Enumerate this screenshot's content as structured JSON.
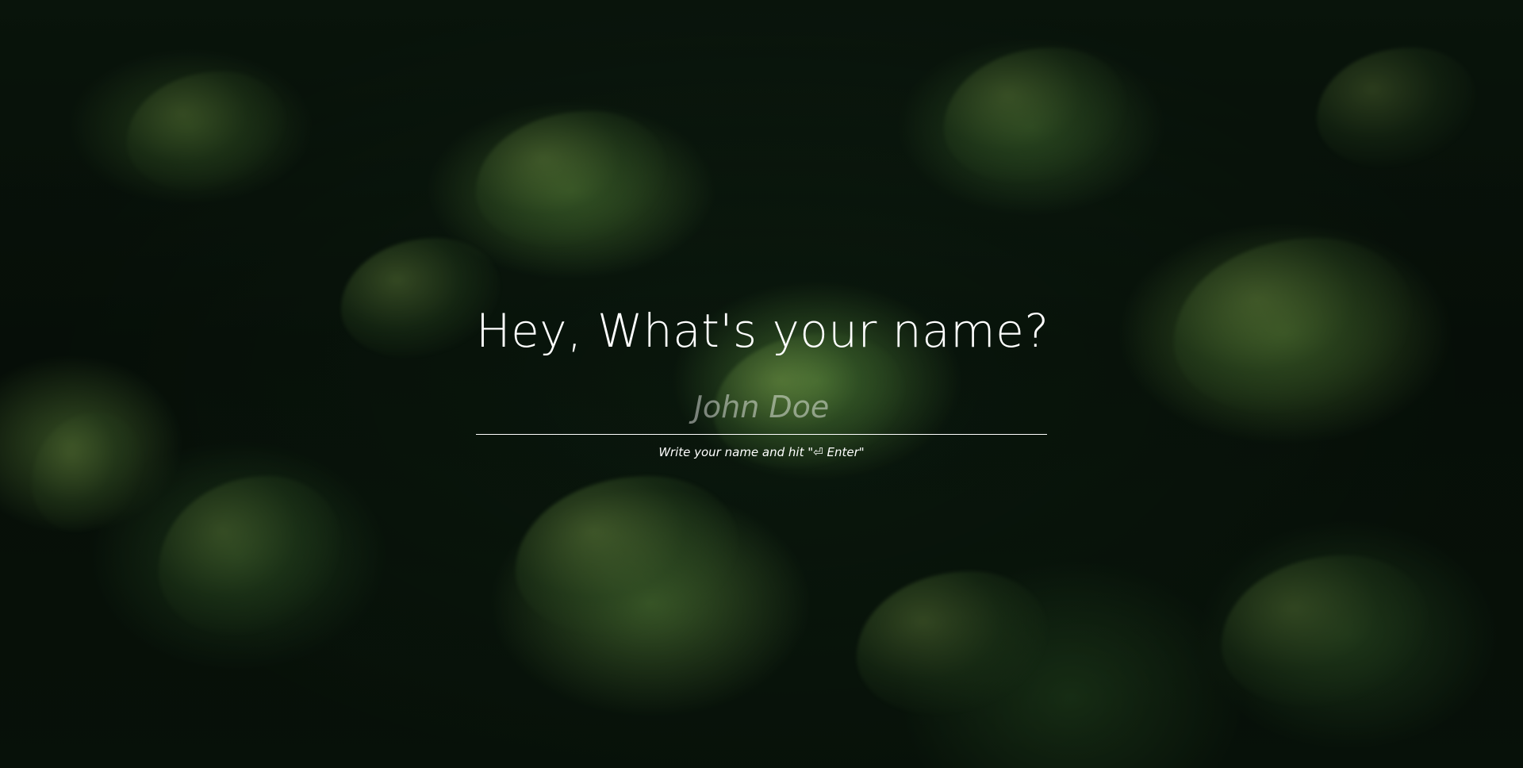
{
  "prompt": {
    "title": "Hey, What's your name?",
    "input_placeholder": "John Doe",
    "input_value": "",
    "hint": "Write your name and hit \"⏎ Enter\""
  },
  "background": {
    "image": "green-leaves-photo",
    "colors": {
      "dark": "#0b1a0e",
      "leaf": "#4f7d36",
      "highlight": "#9db85a"
    }
  },
  "colors": {
    "text": "#ffffff",
    "placeholder": "rgba(255,255,255,0.45)",
    "underline": "#ffffff"
  }
}
